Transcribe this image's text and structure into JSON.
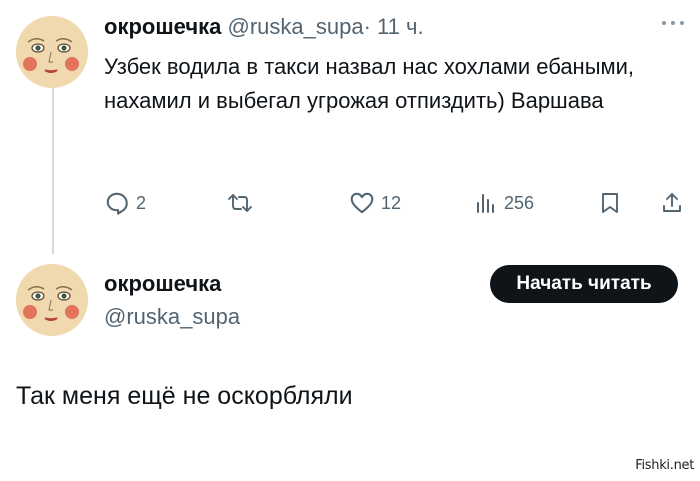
{
  "tweet": {
    "author_name": "окрошечка",
    "author_handle": "@ruska_supa",
    "separator": "·",
    "time": "11 ч.",
    "more_icon": "more-horizontal-icon",
    "text": "Узбек водила в такси назвал нас хохлами ебаными, нахамил и выбегал угрожая отпиздить) Варшава",
    "actions": {
      "reply_count": "2",
      "retweet_count": "",
      "like_count": "12",
      "views_count": "256"
    }
  },
  "profile": {
    "name": "окрошечка",
    "handle": "@ruska_supa",
    "follow_label": "Начать читать"
  },
  "reply": {
    "text": "Так меня ещё не оскорбляли"
  },
  "watermark": "Fishki.net",
  "colors": {
    "text": "#0f1419",
    "secondary": "#536471",
    "button_bg": "#0f1419",
    "button_text": "#ffffff",
    "thread_line": "#cfd9de",
    "avatar_bg": "#f0d9ae",
    "blush": "#e0604b"
  }
}
